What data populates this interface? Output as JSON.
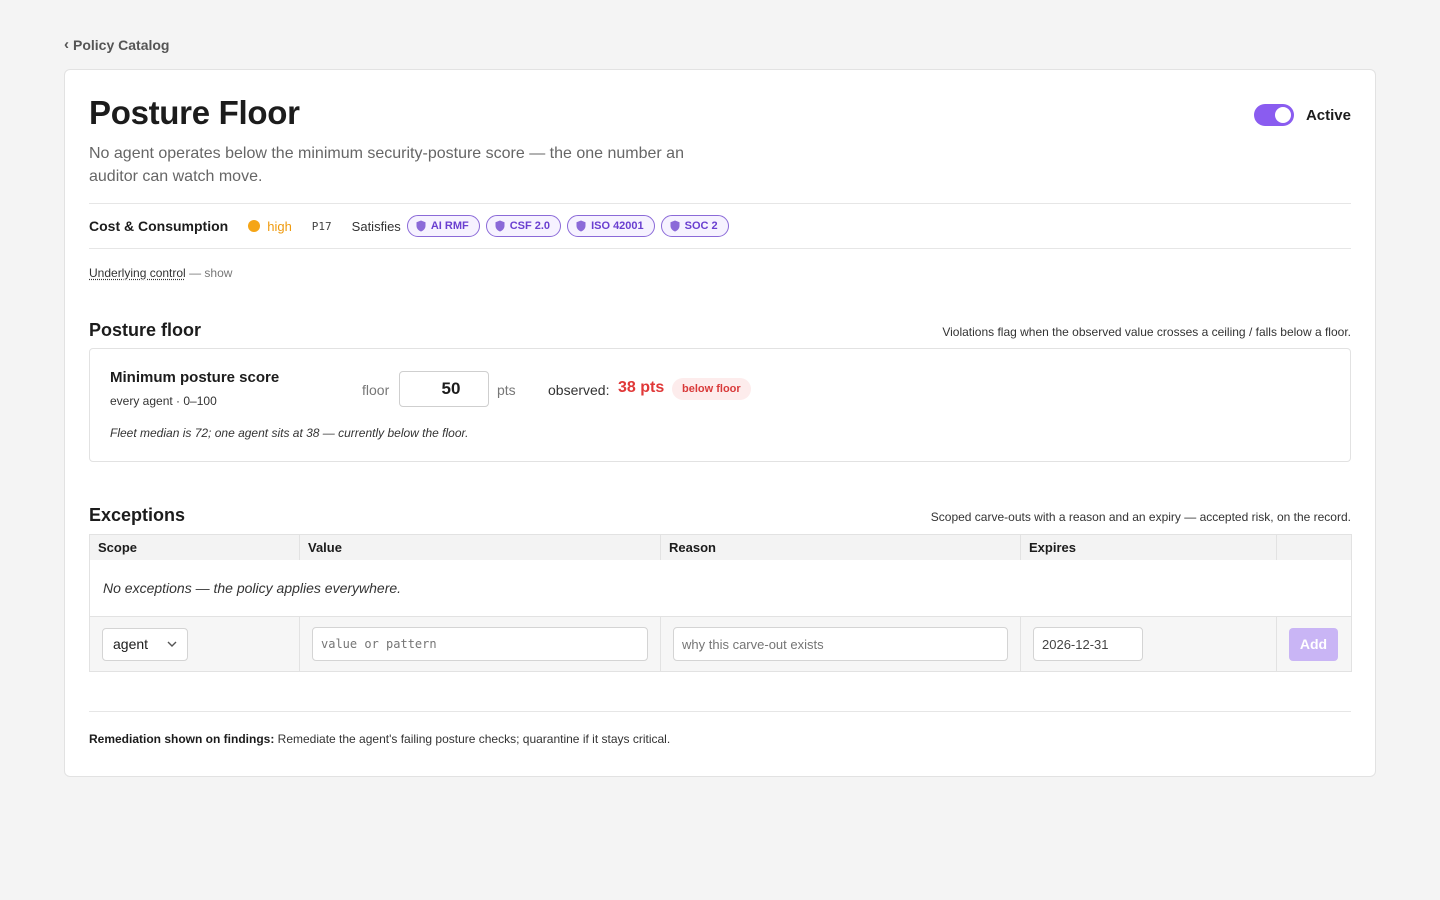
{
  "breadcrumb": {
    "label": "Policy Catalog"
  },
  "policy": {
    "title": "Posture Floor",
    "description": "No agent operates below the minimum security-posture score — the one number an auditor can watch move.",
    "status_label": "Active",
    "active": true,
    "category": "Cost & Consumption",
    "severity": "high",
    "priority": "P17",
    "satisfies_label": "Satisfies",
    "frameworks": [
      "AI RMF",
      "CSF 2.0",
      "ISO 42001",
      "SOC 2"
    ],
    "underlying_control_label": "Underlying control",
    "underlying_control_action": "— show"
  },
  "colors": {
    "accent": "#8a5cf0",
    "severity_high": "#f5a516",
    "violation": "#e03838"
  },
  "posture_floor": {
    "section_title": "Posture floor",
    "section_hint": "Violations flag when the observed value crosses a ceiling / falls below a floor.",
    "metric_name": "Minimum posture score",
    "metric_scope": "every agent · 0–100",
    "floor_label": "floor",
    "floor_value": "50",
    "unit": "pts",
    "observed_label": "observed:",
    "observed_value": "38 pts",
    "status_badge": "below floor",
    "note": "Fleet median is 72; one agent sits at 38 — currently below the floor."
  },
  "exceptions": {
    "section_title": "Exceptions",
    "section_hint": "Scoped carve-outs with a reason and an expiry — accepted risk, on the record.",
    "columns": [
      "Scope",
      "Value",
      "Reason",
      "Expires",
      ""
    ],
    "empty_message": "No exceptions — the policy applies everywhere.",
    "new": {
      "scope_selected": "agent",
      "value_placeholder": "value or pattern",
      "reason_placeholder": "why this carve-out exists",
      "expires_value": "2026-12-31",
      "add_label": "Add"
    }
  },
  "remediation": {
    "label": "Remediation shown on findings:",
    "text": "Remediate the agent's failing posture checks; quarantine if it stays critical."
  }
}
